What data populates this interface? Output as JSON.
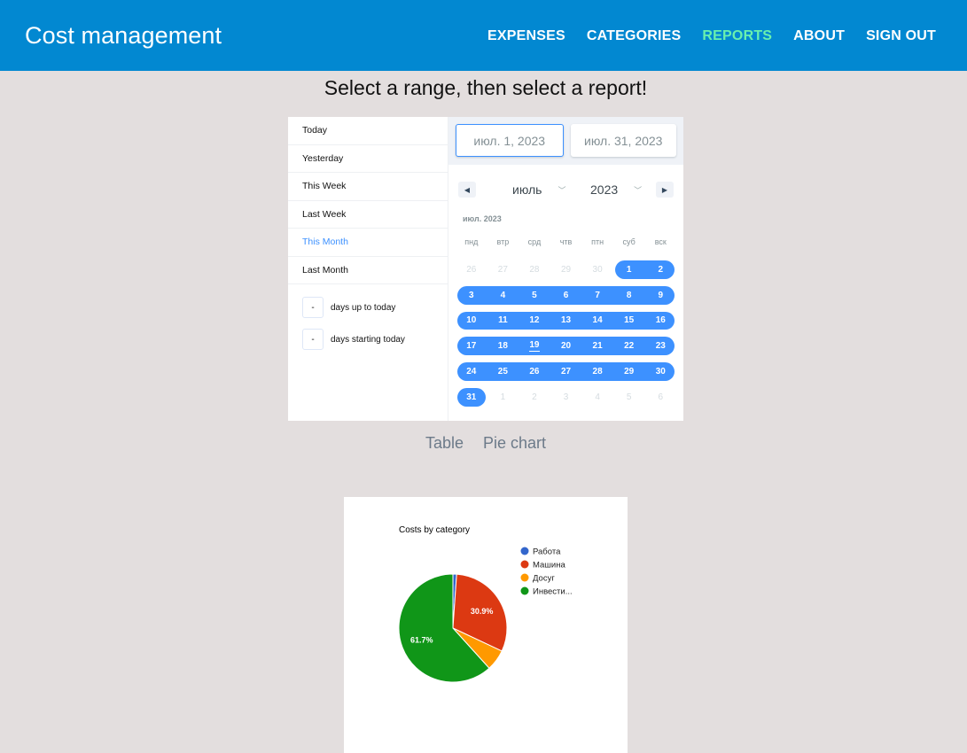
{
  "app": {
    "title": "Cost management",
    "nav": [
      {
        "label": "EXPENSES",
        "active": false
      },
      {
        "label": "CATEGORIES",
        "active": false
      },
      {
        "label": "REPORTS",
        "active": true
      },
      {
        "label": "ABOUT",
        "active": false
      },
      {
        "label": "SIGN OUT",
        "active": false
      }
    ]
  },
  "headline": "Select a range, then select a report!",
  "picker": {
    "static_ranges": [
      {
        "label": "Today",
        "active": false
      },
      {
        "label": "Yesterday",
        "active": false
      },
      {
        "label": "This Week",
        "active": false
      },
      {
        "label": "Last Week",
        "active": false
      },
      {
        "label": "This Month",
        "active": true
      },
      {
        "label": "Last Month",
        "active": false
      }
    ],
    "input_ranges": [
      {
        "value": "-",
        "label": "days up to today"
      },
      {
        "value": "-",
        "label": "days starting today"
      }
    ],
    "start_date": "июл. 1, 2023",
    "end_date": "июл. 31, 2023",
    "month_select": "июль",
    "year_select": "2023",
    "month_label": "июл. 2023",
    "weekdays": [
      "пнд",
      "втр",
      "срд",
      "чтв",
      "птн",
      "суб",
      "вск"
    ],
    "weeks": [
      [
        {
          "d": "26",
          "p": true
        },
        {
          "d": "27",
          "p": true
        },
        {
          "d": "28",
          "p": true
        },
        {
          "d": "29",
          "p": true
        },
        {
          "d": "30",
          "p": true
        },
        {
          "d": "1",
          "r": "start"
        },
        {
          "d": "2",
          "r": "end"
        }
      ],
      [
        {
          "d": "3",
          "r": "start"
        },
        {
          "d": "4",
          "r": "mid"
        },
        {
          "d": "5",
          "r": "mid"
        },
        {
          "d": "6",
          "r": "mid"
        },
        {
          "d": "7",
          "r": "mid"
        },
        {
          "d": "8",
          "r": "mid"
        },
        {
          "d": "9",
          "r": "end"
        }
      ],
      [
        {
          "d": "10",
          "r": "start"
        },
        {
          "d": "11",
          "r": "mid"
        },
        {
          "d": "12",
          "r": "mid"
        },
        {
          "d": "13",
          "r": "mid"
        },
        {
          "d": "14",
          "r": "mid"
        },
        {
          "d": "15",
          "r": "mid"
        },
        {
          "d": "16",
          "r": "end"
        }
      ],
      [
        {
          "d": "17",
          "r": "start"
        },
        {
          "d": "18",
          "r": "mid"
        },
        {
          "d": "19",
          "r": "mid",
          "today": true
        },
        {
          "d": "20",
          "r": "mid"
        },
        {
          "d": "21",
          "r": "mid"
        },
        {
          "d": "22",
          "r": "mid"
        },
        {
          "d": "23",
          "r": "end"
        }
      ],
      [
        {
          "d": "24",
          "r": "start"
        },
        {
          "d": "25",
          "r": "mid"
        },
        {
          "d": "26",
          "r": "mid"
        },
        {
          "d": "27",
          "r": "mid"
        },
        {
          "d": "28",
          "r": "mid"
        },
        {
          "d": "29",
          "r": "mid"
        },
        {
          "d": "30",
          "r": "end"
        }
      ],
      [
        {
          "d": "31",
          "r": "both"
        },
        {
          "d": "1",
          "p": true
        },
        {
          "d": "2",
          "p": true
        },
        {
          "d": "3",
          "p": true
        },
        {
          "d": "4",
          "p": true
        },
        {
          "d": "5",
          "p": true
        },
        {
          "d": "6",
          "p": true
        }
      ]
    ],
    "accent_color": "#3d91ff"
  },
  "report_tabs": [
    "Table",
    "Pie chart"
  ],
  "chart_data": {
    "type": "pie",
    "title": "Costs by category",
    "slices": [
      {
        "name": "Работа",
        "value": 1.1,
        "color": "#3366cc"
      },
      {
        "name": "Машина",
        "value": 30.9,
        "color": "#dc3912",
        "label": "30.9%"
      },
      {
        "name": "Досуг",
        "value": 6.3,
        "color": "#ff9900"
      },
      {
        "name": "Инвести...",
        "value": 61.7,
        "color": "#109618",
        "label": "61.7%"
      }
    ],
    "legend_position": "right"
  }
}
